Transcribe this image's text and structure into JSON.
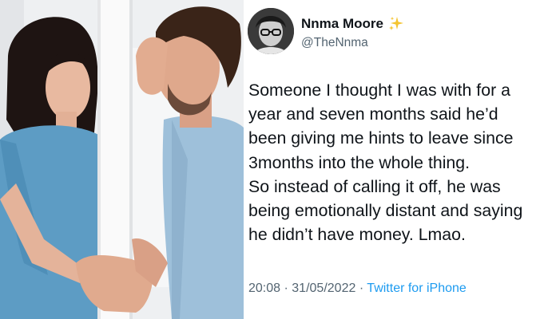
{
  "tweet": {
    "author": {
      "display_name": "Nnma Moore",
      "handle": "@TheNnma",
      "badge_icon": "sparkles-icon"
    },
    "lines": [
      "Someone I thought I was with for a",
      "year and seven months said he’d",
      "been giving me hints to leave since",
      "3months into the whole thing.",
      "So instead of calling it off, he was",
      "being emotionally distant and saying",
      "he didn’t have money. Lmao."
    ],
    "time": "20:08",
    "date": "31/05/2022",
    "separator": "·",
    "source": "Twitter for iPhone"
  },
  "colors": {
    "text_primary": "#0f1419",
    "text_secondary": "#536471",
    "link": "#1d9bf0",
    "sparkle": "#f4c430"
  }
}
